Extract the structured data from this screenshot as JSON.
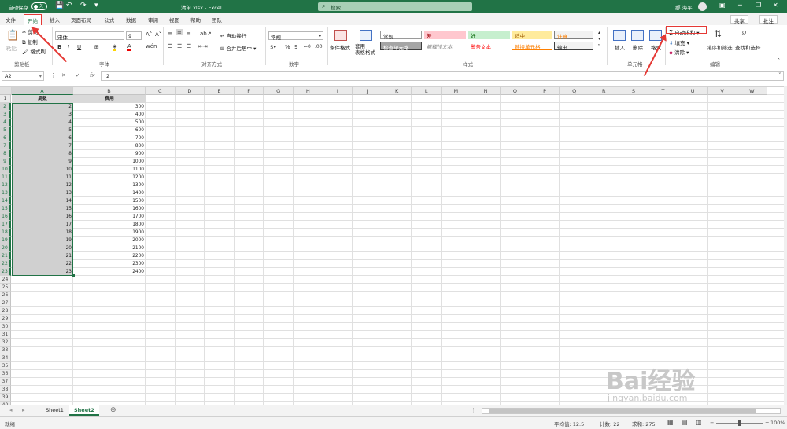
{
  "titlebar": {
    "autosave": "自动保存",
    "autosave_state": "关",
    "doc_title": "清单.xlsx  -  Excel",
    "search": "搜索",
    "user": "郝 海平"
  },
  "tabs": [
    "文件",
    "开始",
    "插入",
    "页面布局",
    "公式",
    "数据",
    "审阅",
    "视图",
    "帮助",
    "团队"
  ],
  "share": {
    "share": "共享",
    "comment": "批注"
  },
  "clipboard": {
    "paste": "粘贴",
    "cut": "剪切",
    "copy": "复制",
    "painter": "格式刷",
    "label": "剪贴板"
  },
  "font": {
    "name": "宋体",
    "size": "9",
    "label": "字体"
  },
  "alignment": {
    "wrap": "自动换行",
    "merge": "合并后居中",
    "label": "对齐方式"
  },
  "number": {
    "format": "常规",
    "label": "数字"
  },
  "styles": {
    "cond": "条件格式",
    "table": "套用\n表格格式",
    "label": "样式",
    "items": [
      "常规",
      "差",
      "好",
      "适中",
      "计算",
      "检查单元格",
      "解释性文本",
      "警告文本",
      "链接单元格",
      "输出"
    ]
  },
  "cells": {
    "insert": "插入",
    "delete": "删除",
    "format": "格式",
    "label": "单元格"
  },
  "editing": {
    "autosum": "自动求和",
    "fill": "填充",
    "clear": "清除",
    "sort": "排序和筛选",
    "find": "查找和选择",
    "label": "编辑"
  },
  "formulabar": {
    "namebox": "A2",
    "fx": "fx",
    "value": "2"
  },
  "columns": [
    "A",
    "B",
    "C",
    "D",
    "E",
    "F",
    "G",
    "H",
    "I",
    "J",
    "K",
    "L",
    "M",
    "N",
    "O",
    "P",
    "Q",
    "R",
    "S",
    "T",
    "U",
    "V",
    "W"
  ],
  "headers": {
    "a": "周数",
    "b": "费用"
  },
  "rows": [
    [
      "2",
      "300"
    ],
    [
      "3",
      "400"
    ],
    [
      "4",
      "500"
    ],
    [
      "5",
      "600"
    ],
    [
      "6",
      "700"
    ],
    [
      "7",
      "800"
    ],
    [
      "8",
      "900"
    ],
    [
      "9",
      "1000"
    ],
    [
      "10",
      "1100"
    ],
    [
      "11",
      "1200"
    ],
    [
      "12",
      "1300"
    ],
    [
      "13",
      "1400"
    ],
    [
      "14",
      "1500"
    ],
    [
      "15",
      "1600"
    ],
    [
      "16",
      "1700"
    ],
    [
      "17",
      "1800"
    ],
    [
      "18",
      "1900"
    ],
    [
      "19",
      "2000"
    ],
    [
      "20",
      "2100"
    ],
    [
      "21",
      "2200"
    ],
    [
      "22",
      "2300"
    ],
    [
      "23",
      "2400"
    ]
  ],
  "row_numbers": [
    "1",
    "2",
    "3",
    "4",
    "5",
    "6",
    "7",
    "8",
    "9",
    "10",
    "11",
    "12",
    "13",
    "14",
    "15",
    "16",
    "17",
    "18",
    "19",
    "20",
    "21",
    "22",
    "23",
    "24",
    "25",
    "26",
    "27",
    "28",
    "29",
    "30",
    "31",
    "32",
    "33",
    "34",
    "35",
    "36",
    "37",
    "38",
    "39",
    "40"
  ],
  "sheets": [
    "Sheet1",
    "Sheet2"
  ],
  "status": {
    "mode": "就绪",
    "avg": "平均值: 12.5",
    "count": "计数: 22",
    "sum": "求和: 275",
    "zoom": "100%"
  },
  "watermark": {
    "brand": "Bai经验",
    "url": "jingyan.baidu.com"
  }
}
